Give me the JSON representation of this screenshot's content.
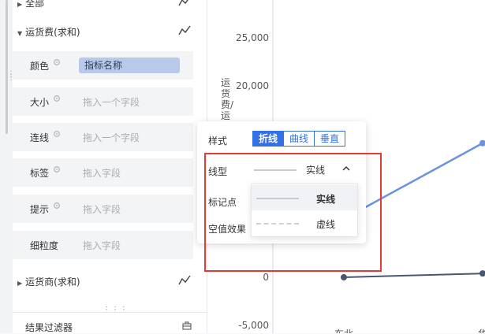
{
  "left_panel": {
    "top_group": "全部",
    "group1": "运货费(求和)",
    "properties": [
      {
        "label": "颜色",
        "value": "指标名称"
      },
      {
        "label": "大小",
        "placeholder": "拖入一个字段"
      },
      {
        "label": "连线",
        "placeholder": "拖入一个字段"
      },
      {
        "label": "标签",
        "placeholder": "拖入字段"
      },
      {
        "label": "提示",
        "placeholder": "拖入字段"
      },
      {
        "label": "细粒度",
        "placeholder": "拖入字段"
      }
    ],
    "group2": "运货商(求和)",
    "filter": "结果过滤器"
  },
  "chart": {
    "y_axis_label": "运货费/运",
    "y_ticks": [
      "25,000",
      "20,000",
      "0",
      "-5,000"
    ],
    "x_ticks": [
      "东北",
      "华"
    ]
  },
  "chart_data": {
    "type": "line",
    "ylabel": "运货费/运",
    "ylim": [
      -5000,
      25000
    ],
    "categories": [
      "东北",
      "华"
    ],
    "series": [
      {
        "color": "#6b93e0",
        "values": [
          null,
          14000
        ]
      },
      {
        "color": "#4a5670",
        "values": [
          0,
          400
        ]
      }
    ]
  },
  "popup": {
    "style_label": "样式",
    "style_options": [
      "折线",
      "曲线",
      "垂直"
    ],
    "style_selected": "折线",
    "line_type_label": "线型",
    "line_type_value": "实线",
    "marker_label": "标记点",
    "empty_label": "空值效果",
    "dropdown_options": [
      "实线",
      "虚线"
    ]
  },
  "colors": {
    "accent": "#3471e6",
    "highlight": "#e53935"
  }
}
